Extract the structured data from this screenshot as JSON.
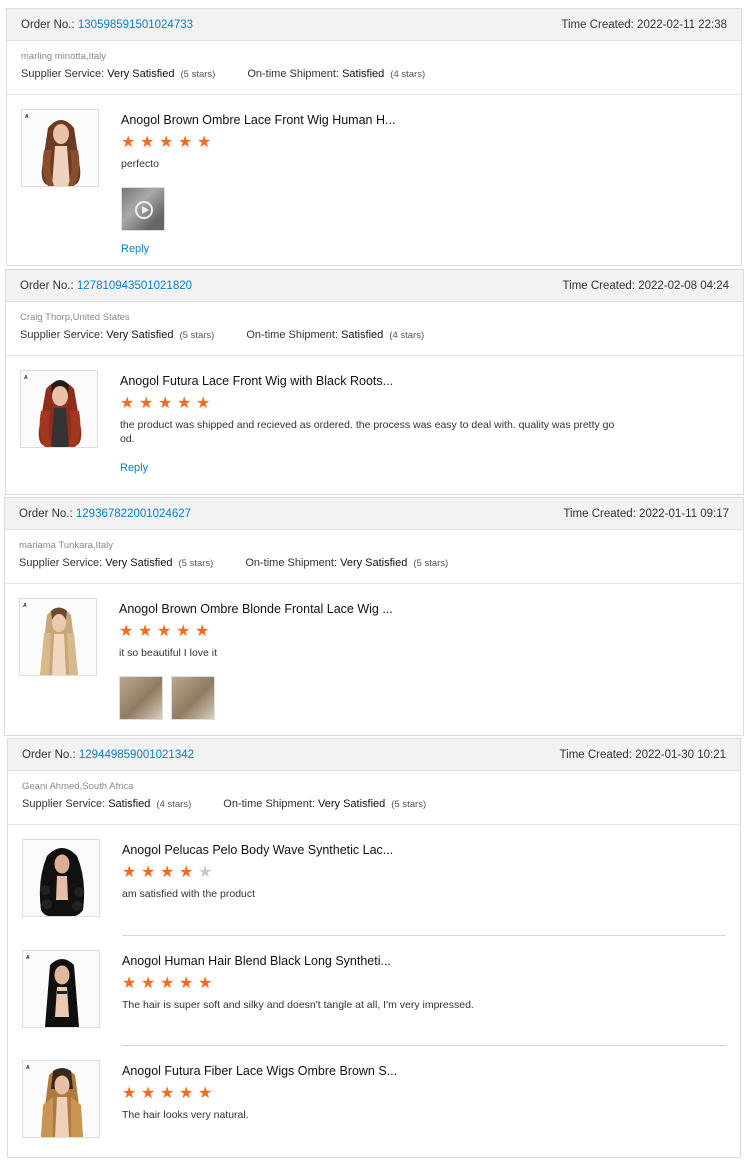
{
  "colors": {
    "accent_blue": "#0a7fc7",
    "star_orange": "#f36c21",
    "header_bg": "#f2f2f2"
  },
  "labels": {
    "order_no": "Order No.:",
    "time_created": "Time Created:",
    "supplier_service": "Supplier Service:",
    "ontime_shipment": "On-time Shipment:",
    "reply": "Reply"
  },
  "orders": [
    {
      "order_no": "130598591501024733",
      "time": "2022-02-11 22:38",
      "buyer": "marling minotta,Italy",
      "supplier_rating": "Very Satisfied",
      "supplier_stars": "(5 stars)",
      "shipment_rating": "Satisfied",
      "shipment_stars": "(4 stars)",
      "items": [
        {
          "title": "Anogol Brown Ombre Lace Front Wig Human H...",
          "rating": 5,
          "comment": "perfecto",
          "photos": [
            "video-thumbnail"
          ]
        }
      ]
    },
    {
      "order_no": "127810943501021820",
      "time": "2022-02-08 04:24",
      "buyer": "Craig Thorp,United States",
      "supplier_rating": "Very Satisfied",
      "supplier_stars": "(5 stars)",
      "shipment_rating": "Satisfied",
      "shipment_stars": "(4 stars)",
      "items": [
        {
          "title": "Anogol Futura Lace Front Wig with Black Roots...",
          "rating": 5,
          "comment": "the product was shipped and recieved as ordered. the process was easy to deal with. quality was pretty go od.",
          "photos": []
        }
      ]
    },
    {
      "order_no": "129367822001024627",
      "time": "2022-01-11 09:17",
      "buyer": "mariama Tunkara,Italy",
      "supplier_rating": "Very Satisfied",
      "supplier_stars": "(5 stars)",
      "shipment_rating": "Very Satisfied",
      "shipment_stars": "(5 stars)",
      "items": [
        {
          "title": "Anogol Brown Ombre Blonde Frontal Lace Wig ...",
          "rating": 5,
          "comment": "it so beautiful I love it",
          "photos": [
            "photo",
            "photo"
          ]
        }
      ]
    },
    {
      "order_no": "129449859001021342",
      "time": "2022-01-30 10:21",
      "buyer": "Geani Ahmed,South Africa",
      "supplier_rating": "Satisfied",
      "supplier_stars": "(4 stars)",
      "shipment_rating": "Very Satisfied",
      "shipment_stars": "(5 stars)",
      "items": [
        {
          "title": "Anogol Pelucas Pelo Body Wave Synthetic Lac...",
          "rating": 4,
          "comment": "am satisfied with the product",
          "photos": []
        },
        {
          "title": "Anogol Human Hair Blend Black Long Syntheti...",
          "rating": 5,
          "comment": "The hair is super soft and silky and doesn't tangle at all, I'm very impressed.",
          "photos": []
        },
        {
          "title": "Anogol Futura Fiber Lace Wigs Ombre Brown S...",
          "rating": 5,
          "comment": "The hair looks very natural.",
          "photos": []
        }
      ]
    }
  ]
}
